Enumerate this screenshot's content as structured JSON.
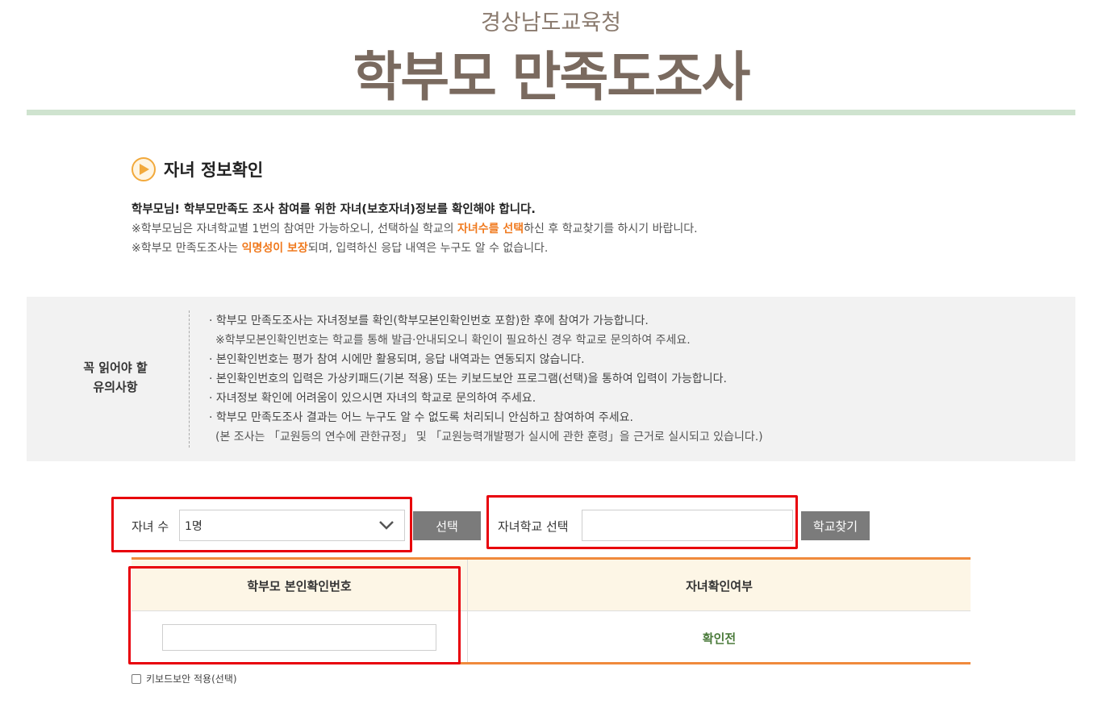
{
  "header": {
    "org": "경상남도교육청",
    "title": "학부모 만족도조사"
  },
  "section": {
    "title": "자녀 정보확인",
    "intro_bold": "학부모님! 학부모만족도 조사 참여를 위한 자녀(보호자녀)정보를 확인해야 합니다.",
    "line2_pre": "※학부모님은 자녀학교별 1번의 참여만 가능하오니, 선택하실 학교의 ",
    "line2_hl": "자녀수를 선택",
    "line2_post": "하신 후 학교찾기를 하시기 바랍니다.",
    "line3_pre": "※학부모 만족도조사는 ",
    "line3_hl": "익명성이 보장",
    "line3_post": "되며, 입력하신 응답 내역은 누구도 알 수 없습니다."
  },
  "notice": {
    "label_line1": "꼭 읽어야 할",
    "label_line2": "유의사항",
    "items": [
      "· 학부모 만족도조사는 자녀정보를 확인(학부모본인확인번호 포함)한 후에 참여가 가능합니다.",
      "※학부모본인확인번호는 학교를 통해 발급·안내되오니 확인이 필요하신 경우 학교로 문의하여 주세요.",
      "· 본인확인번호는 평가 참여 시에만 활용되며, 응답 내역과는 연동되지 않습니다.",
      "· 본인확인번호의 입력은 가상키패드(기본 적용) 또는 키보드보안 프로그램(선택)을 통하여 입력이 가능합니다.",
      "· 자녀정보 확인에 어려움이 있으시면 자녀의 학교로 문의하여 주세요.",
      "· 학부모 만족도조사 결과는 어느 누구도 알 수 없도록 처리되니 안심하고 참여하여 주세요.",
      "(본 조사는 「교원등의 연수에 관한규정」 및 「교원능력개발평가 실시에 관한 훈령」을 근거로 실시되고 있습니다.)"
    ]
  },
  "form": {
    "children_label": "자녀 수",
    "children_value": "1명",
    "select_button": "선택",
    "school_label": "자녀학교 선택",
    "school_value": "",
    "find_school_button": "학교찾기"
  },
  "table": {
    "col1_header": "학부모 본인확인번호",
    "col2_header": "자녀확인여부",
    "pin_value": "",
    "status": "확인전"
  },
  "keyboard_security": {
    "label": "키보드보안 적용(선택)",
    "checked": false
  },
  "colors": {
    "accent_orange": "#f07a1f",
    "table_border": "#f08a3c",
    "highlight_red": "#e8000b",
    "status_green": "#4a7a3a"
  }
}
